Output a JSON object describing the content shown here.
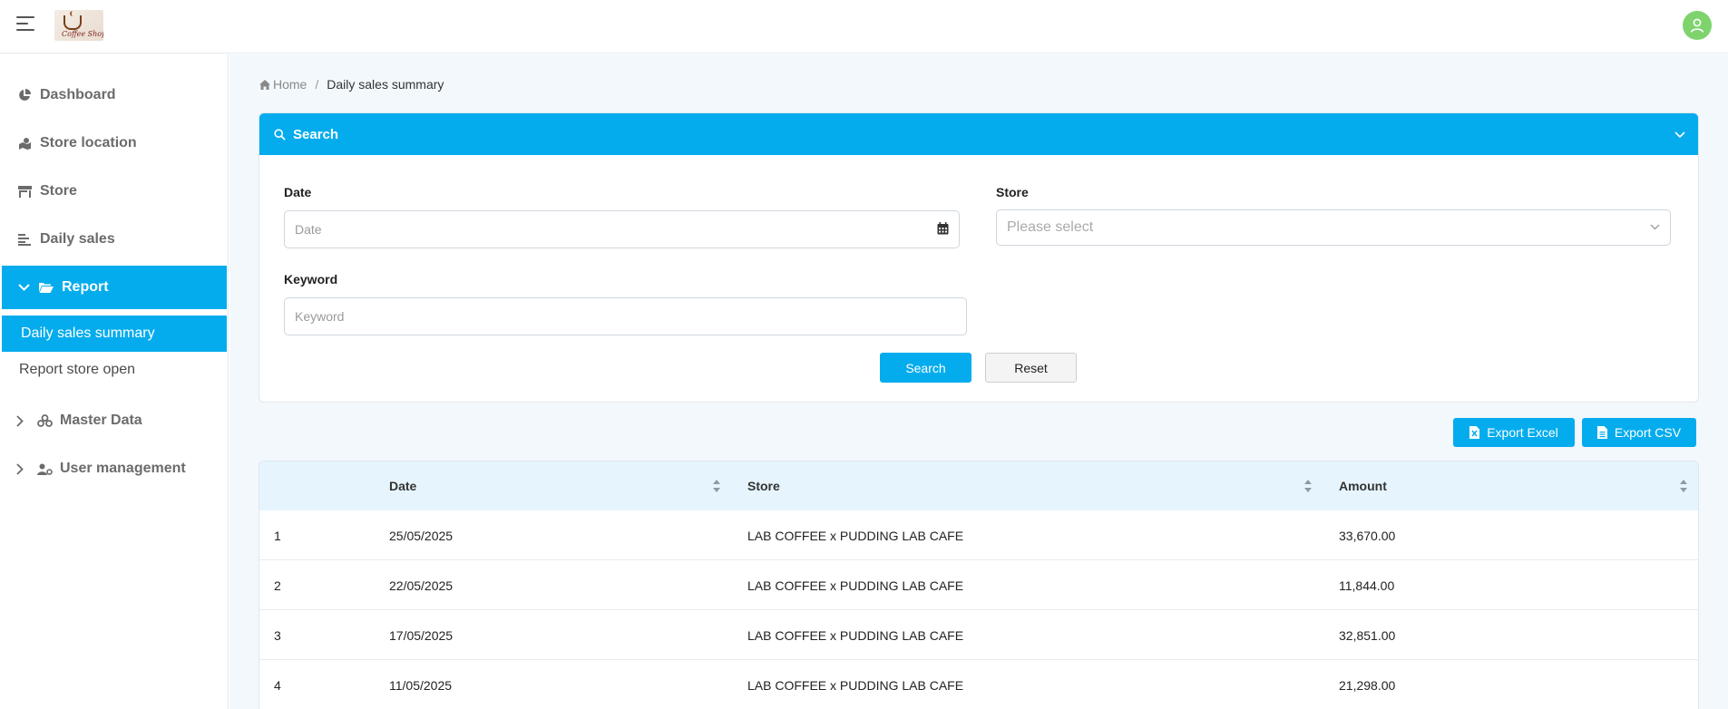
{
  "header": {
    "logo_text": "Coffee Shop"
  },
  "sidebar": {
    "items": [
      {
        "label": "Dashboard",
        "icon": "pie-chart-icon"
      },
      {
        "label": "Store location",
        "icon": "map-icon"
      },
      {
        "label": "Store",
        "icon": "store-icon"
      },
      {
        "label": "Daily sales",
        "icon": "list-icon"
      },
      {
        "label": "Report",
        "icon": "folder-open-icon",
        "expanded": true,
        "children": [
          "Daily sales summary",
          "Report store open"
        ]
      },
      {
        "label": "Master Data",
        "icon": "cubes-icon"
      },
      {
        "label": "User management",
        "icon": "user-gear-icon"
      }
    ]
  },
  "breadcrumb": {
    "home": "Home",
    "current": "Daily sales summary"
  },
  "search": {
    "title": "Search",
    "date_label": "Date",
    "date_placeholder": "Date",
    "store_label": "Store",
    "store_placeholder": "Please select",
    "keyword_label": "Keyword",
    "keyword_placeholder": "Keyword",
    "search_button": "Search",
    "reset_button": "Reset"
  },
  "actions": {
    "export_excel": "Export Excel",
    "export_csv": "Export CSV"
  },
  "table": {
    "columns": [
      "",
      "Date",
      "Store",
      "Amount"
    ],
    "rows": [
      {
        "no": "1",
        "date": "25/05/2025",
        "store": "LAB COFFEE x PUDDING LAB CAFE",
        "amount": "33,670.00"
      },
      {
        "no": "2",
        "date": "22/05/2025",
        "store": "LAB COFFEE x PUDDING LAB CAFE",
        "amount": "11,844.00"
      },
      {
        "no": "3",
        "date": "17/05/2025",
        "store": "LAB COFFEE x PUDDING LAB CAFE",
        "amount": "32,851.00"
      },
      {
        "no": "4",
        "date": "11/05/2025",
        "store": "LAB COFFEE x PUDDING LAB CAFE",
        "amount": "21,298.00"
      }
    ]
  },
  "colors": {
    "accent": "#04aced",
    "avatar": "#7ed36d",
    "table_header_bg": "#e6f5fd"
  }
}
